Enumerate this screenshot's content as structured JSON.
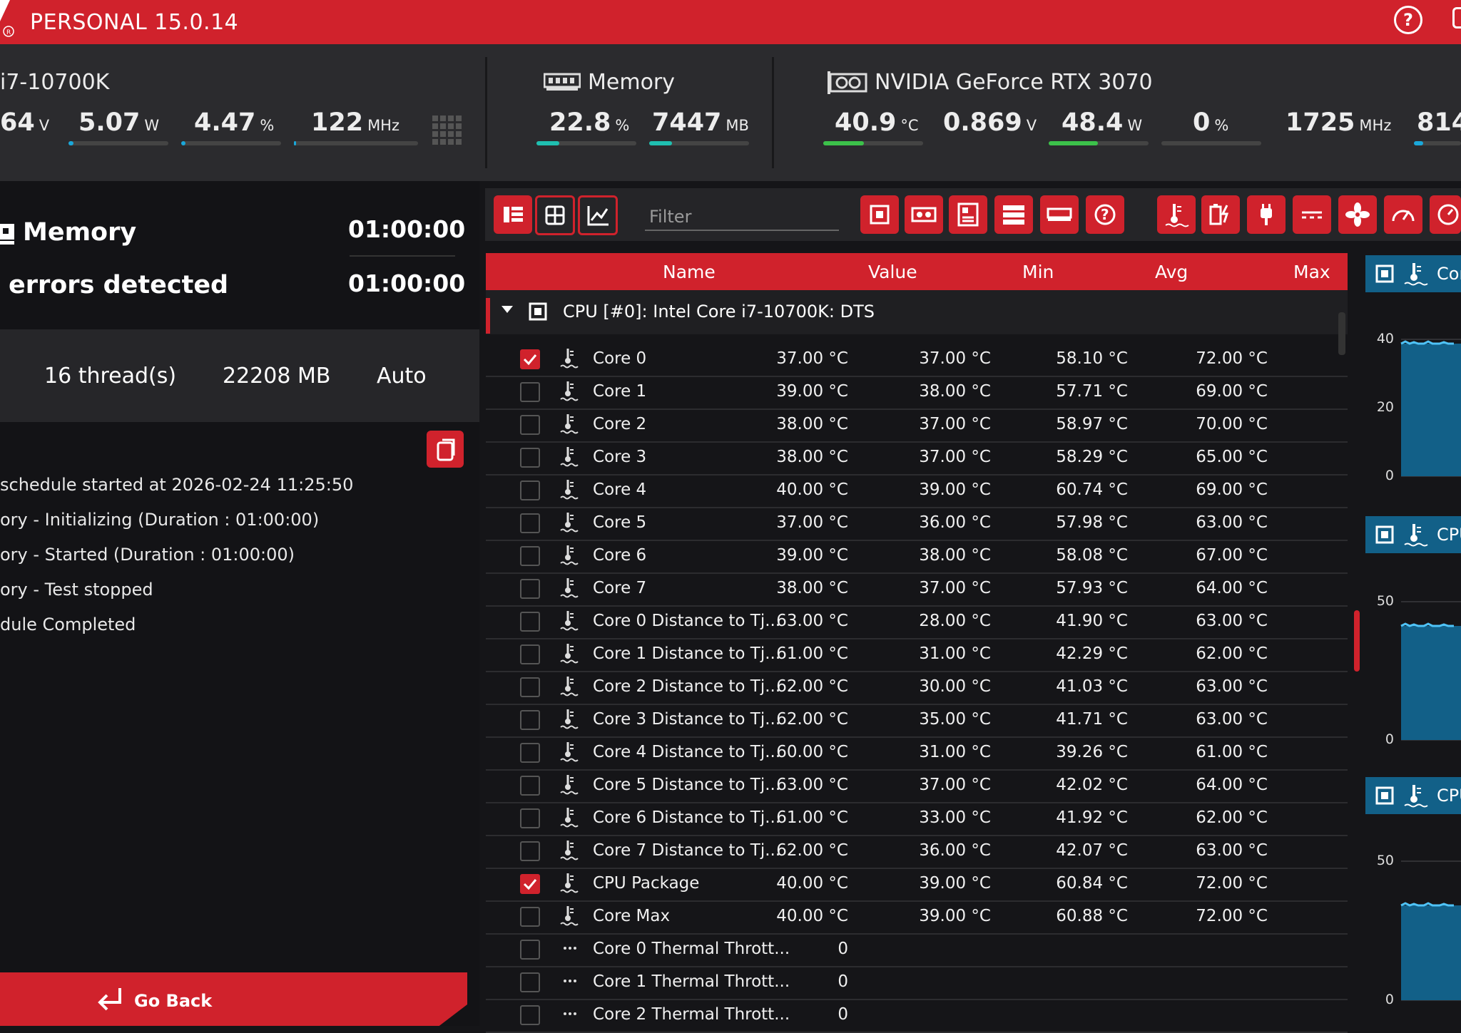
{
  "app": {
    "title": "PERSONAL 15.0.14"
  },
  "header": {
    "cpu": {
      "name": "i7-10700K",
      "stats": [
        {
          "value": "64",
          "unit": "V",
          "fraction": 0
        },
        {
          "value": "5.07",
          "unit": "W",
          "fraction": 0.05
        },
        {
          "value": "4.47",
          "unit": "%",
          "fraction": 0.04
        },
        {
          "value": "122",
          "unit": "MHz",
          "fraction": 0.02
        }
      ]
    },
    "memory": {
      "name": "Memory",
      "stats": [
        {
          "value": "22.8",
          "unit": "%",
          "fraction": 0.23
        },
        {
          "value": "7447",
          "unit": "MB",
          "fraction": 0.23
        }
      ]
    },
    "gpu": {
      "name": "NVIDIA GeForce RTX 3070",
      "stats": [
        {
          "value": "40.9",
          "unit": "°C",
          "fraction": 0.41
        },
        {
          "value": "0.869",
          "unit": "V",
          "fraction": 0
        },
        {
          "value": "48.4",
          "unit": "W",
          "fraction": 0.49
        },
        {
          "value": "0",
          "unit": "%",
          "fraction": 0
        },
        {
          "value": "1725",
          "unit": "MHz",
          "fraction": 0
        },
        {
          "value": "814",
          "unit": "",
          "fraction": 0.2
        }
      ]
    }
  },
  "left": {
    "test_name": "Memory",
    "test_time": "01:00:00",
    "errors_label": "errors detected",
    "errors_time": "01:00:00",
    "threads": "16 thread(s)",
    "memory_mb": "22208 MB",
    "mode": "Auto",
    "log": [
      "schedule started at 2026-02-24 11:25:50",
      "ory - Initializing (Duration : 01:00:00)",
      "ory - Started (Duration : 01:00:00)",
      "ory - Test stopped",
      "dule Completed"
    ],
    "go_back": "Go Back"
  },
  "toolbar": {
    "filter_placeholder": "Filter"
  },
  "table": {
    "columns": [
      "Name",
      "Value",
      "Min",
      "Avg",
      "Max"
    ],
    "group": "CPU [#0]: Intel Core i7-10700K: DTS",
    "rows": [
      {
        "checked": true,
        "icon": "thermometer",
        "name": "Core 0",
        "value": "37.00 °C",
        "min": "37.00 °C",
        "avg": "58.10 °C",
        "max": "72.00 °C"
      },
      {
        "checked": false,
        "icon": "thermometer",
        "name": "Core 1",
        "value": "39.00 °C",
        "min": "38.00 °C",
        "avg": "57.71 °C",
        "max": "69.00 °C"
      },
      {
        "checked": false,
        "icon": "thermometer",
        "name": "Core 2",
        "value": "38.00 °C",
        "min": "37.00 °C",
        "avg": "58.97 °C",
        "max": "70.00 °C"
      },
      {
        "checked": false,
        "icon": "thermometer",
        "name": "Core 3",
        "value": "38.00 °C",
        "min": "37.00 °C",
        "avg": "58.29 °C",
        "max": "65.00 °C"
      },
      {
        "checked": false,
        "icon": "thermometer",
        "name": "Core 4",
        "value": "40.00 °C",
        "min": "39.00 °C",
        "avg": "60.74 °C",
        "max": "69.00 °C"
      },
      {
        "checked": false,
        "icon": "thermometer",
        "name": "Core 5",
        "value": "37.00 °C",
        "min": "36.00 °C",
        "avg": "57.98 °C",
        "max": "63.00 °C"
      },
      {
        "checked": false,
        "icon": "thermometer",
        "name": "Core 6",
        "value": "39.00 °C",
        "min": "38.00 °C",
        "avg": "58.08 °C",
        "max": "67.00 °C"
      },
      {
        "checked": false,
        "icon": "thermometer",
        "name": "Core 7",
        "value": "38.00 °C",
        "min": "37.00 °C",
        "avg": "57.93 °C",
        "max": "64.00 °C"
      },
      {
        "checked": false,
        "icon": "thermometer",
        "name": "Core 0 Distance to Tj...",
        "value": "63.00 °C",
        "min": "28.00 °C",
        "avg": "41.90 °C",
        "max": "63.00 °C"
      },
      {
        "checked": false,
        "icon": "thermometer",
        "name": "Core 1 Distance to Tj...",
        "value": "61.00 °C",
        "min": "31.00 °C",
        "avg": "42.29 °C",
        "max": "62.00 °C"
      },
      {
        "checked": false,
        "icon": "thermometer",
        "name": "Core 2 Distance to Tj...",
        "value": "62.00 °C",
        "min": "30.00 °C",
        "avg": "41.03 °C",
        "max": "63.00 °C"
      },
      {
        "checked": false,
        "icon": "thermometer",
        "name": "Core 3 Distance to Tj...",
        "value": "62.00 °C",
        "min": "35.00 °C",
        "avg": "41.71 °C",
        "max": "63.00 °C"
      },
      {
        "checked": false,
        "icon": "thermometer",
        "name": "Core 4 Distance to Tj...",
        "value": "60.00 °C",
        "min": "31.00 °C",
        "avg": "39.26 °C",
        "max": "61.00 °C"
      },
      {
        "checked": false,
        "icon": "thermometer",
        "name": "Core 5 Distance to Tj...",
        "value": "63.00 °C",
        "min": "37.00 °C",
        "avg": "42.02 °C",
        "max": "64.00 °C"
      },
      {
        "checked": false,
        "icon": "thermometer",
        "name": "Core 6 Distance to Tj...",
        "value": "61.00 °C",
        "min": "33.00 °C",
        "avg": "41.92 °C",
        "max": "62.00 °C"
      },
      {
        "checked": false,
        "icon": "thermometer",
        "name": "Core 7 Distance to Tj...",
        "value": "62.00 °C",
        "min": "36.00 °C",
        "avg": "42.07 °C",
        "max": "63.00 °C"
      },
      {
        "checked": true,
        "icon": "thermometer",
        "name": "CPU Package",
        "value": "40.00 °C",
        "min": "39.00 °C",
        "avg": "60.84 °C",
        "max": "72.00 °C"
      },
      {
        "checked": false,
        "icon": "thermometer",
        "name": "Core Max",
        "value": "40.00 °C",
        "min": "39.00 °C",
        "avg": "60.88 °C",
        "max": "72.00 °C"
      },
      {
        "checked": false,
        "icon": "dots",
        "name": "Core 0 Thermal Thrott...",
        "value": "0",
        "min": "",
        "avg": "",
        "max": ""
      },
      {
        "checked": false,
        "icon": "dots",
        "name": "Core 1 Thermal Thrott...",
        "value": "0",
        "min": "",
        "avg": "",
        "max": ""
      },
      {
        "checked": false,
        "icon": "dots",
        "name": "Core 2 Thermal Thrott...",
        "value": "0",
        "min": "",
        "avg": "",
        "max": ""
      }
    ]
  },
  "charts": [
    {
      "title": "Cor",
      "ticks": [
        "40",
        "20",
        "0"
      ]
    },
    {
      "title": "CPU",
      "ticks": [
        "50",
        "0"
      ]
    },
    {
      "title": "CPU",
      "ticks": [
        "50",
        "0"
      ]
    }
  ],
  "colors": {
    "accent": "#d0222c",
    "chart": "#126088",
    "bar_blue": "#1aa7d9",
    "bar_green": "#3cc14a",
    "bar_teal": "#1fbfb0"
  }
}
